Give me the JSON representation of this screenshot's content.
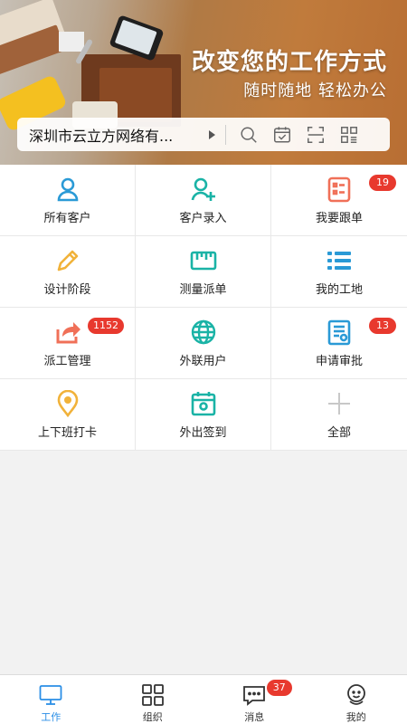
{
  "banner": {
    "slogan_main": "改变您的工作方式",
    "slogan_sub": "随时随地 轻松办公"
  },
  "searchbar": {
    "company_name": "深圳市云立方网络有...",
    "icons": [
      "search-icon",
      "calendar-check-icon",
      "scan-icon",
      "qrcode-icon"
    ]
  },
  "grid": [
    {
      "label": "所有客户",
      "icon": "user-icon",
      "color": "#2a9ad6",
      "badge": ""
    },
    {
      "label": "客户录入",
      "icon": "user-add-icon",
      "color": "#1ab3a6",
      "badge": ""
    },
    {
      "label": "我要跟单",
      "icon": "order-icon",
      "color": "#f07058",
      "badge": "19"
    },
    {
      "label": "设计阶段",
      "icon": "pencil-icon",
      "color": "#f1b23a",
      "badge": ""
    },
    {
      "label": "测量派单",
      "icon": "ruler-icon",
      "color": "#1ab3a6",
      "badge": ""
    },
    {
      "label": "我的工地",
      "icon": "list-icon",
      "color": "#2a9ad6",
      "badge": ""
    },
    {
      "label": "派工管理",
      "icon": "share-icon",
      "color": "#f07058",
      "badge": "1152"
    },
    {
      "label": "外联用户",
      "icon": "globe-icon",
      "color": "#1ab3a6",
      "badge": ""
    },
    {
      "label": "申请审批",
      "icon": "document-icon",
      "color": "#2a9ad6",
      "badge": "13"
    },
    {
      "label": "上下班打卡",
      "icon": "location-pin-icon",
      "color": "#f1b23a",
      "badge": ""
    },
    {
      "label": "外出签到",
      "icon": "checkin-calendar-icon",
      "color": "#1ab3a6",
      "badge": ""
    },
    {
      "label": "全部",
      "icon": "plus-icon",
      "color": "#c8c8c8",
      "badge": ""
    }
  ],
  "tabbar": {
    "tabs": [
      {
        "label": "工作",
        "icon": "monitor-icon",
        "active": true,
        "badge": ""
      },
      {
        "label": "组织",
        "icon": "grid-icon",
        "active": false,
        "badge": ""
      },
      {
        "label": "消息",
        "icon": "message-icon",
        "active": false,
        "badge": "37"
      },
      {
        "label": "我的",
        "icon": "profile-icon",
        "active": false,
        "badge": ""
      }
    ]
  },
  "colors": {
    "accent": "#2a8ee6",
    "badge": "#e8392e"
  }
}
